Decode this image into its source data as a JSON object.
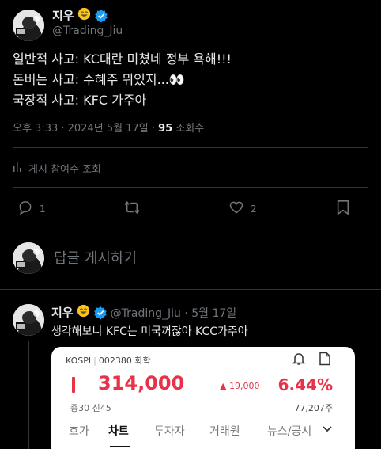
{
  "main_tweet": {
    "display_name": "지우",
    "handle": "@Trading_Jiu",
    "lines": [
      "일반적 사고: KC대란 미쳤네 정부 욕해!!!",
      "돈버는 사고: 수혜주 뭐있지...👀",
      "국장적 사고: KFC 가주아"
    ],
    "time_prefix": "오후 3:33 · 2024년 5월 17일 · ",
    "views_count": "95",
    "views_label": " 조회수",
    "analytics_label": "게시 참여수 조회",
    "reply_count": "1",
    "like_count": "2"
  },
  "reply_composer": {
    "placeholder": "답글 게시하기"
  },
  "reply_tweet": {
    "display_name": "지우",
    "handle_date": "@Trading_Jiu · 5월 17일",
    "text": "생각해보니 KFC는 미국꺼잖아 KCC가주아"
  },
  "stock_card": {
    "market": "KOSPI",
    "code": "002380",
    "sector": "화학",
    "price": "314,000",
    "change": "▲ 19,000",
    "change_pct": "6.44%",
    "margin_info": "증30  신45",
    "volume": "77,207주",
    "tabs": [
      "호가",
      "차트",
      "투자자",
      "거래원",
      "뉴스/공시"
    ],
    "active_tab": "차트"
  },
  "colors": {
    "background": "#000000",
    "text": "#e7e9ea",
    "muted": "#71767b",
    "divider": "#2f3336",
    "verified": "#1d9bf0",
    "stock_up": "#e8324a"
  },
  "icons": [
    "smile-emoji-icon",
    "verified-badge-icon",
    "analytics-icon",
    "reply-icon",
    "retweet-icon",
    "like-icon",
    "bookmark-icon",
    "bell-icon",
    "document-icon",
    "chevron-down-icon"
  ]
}
